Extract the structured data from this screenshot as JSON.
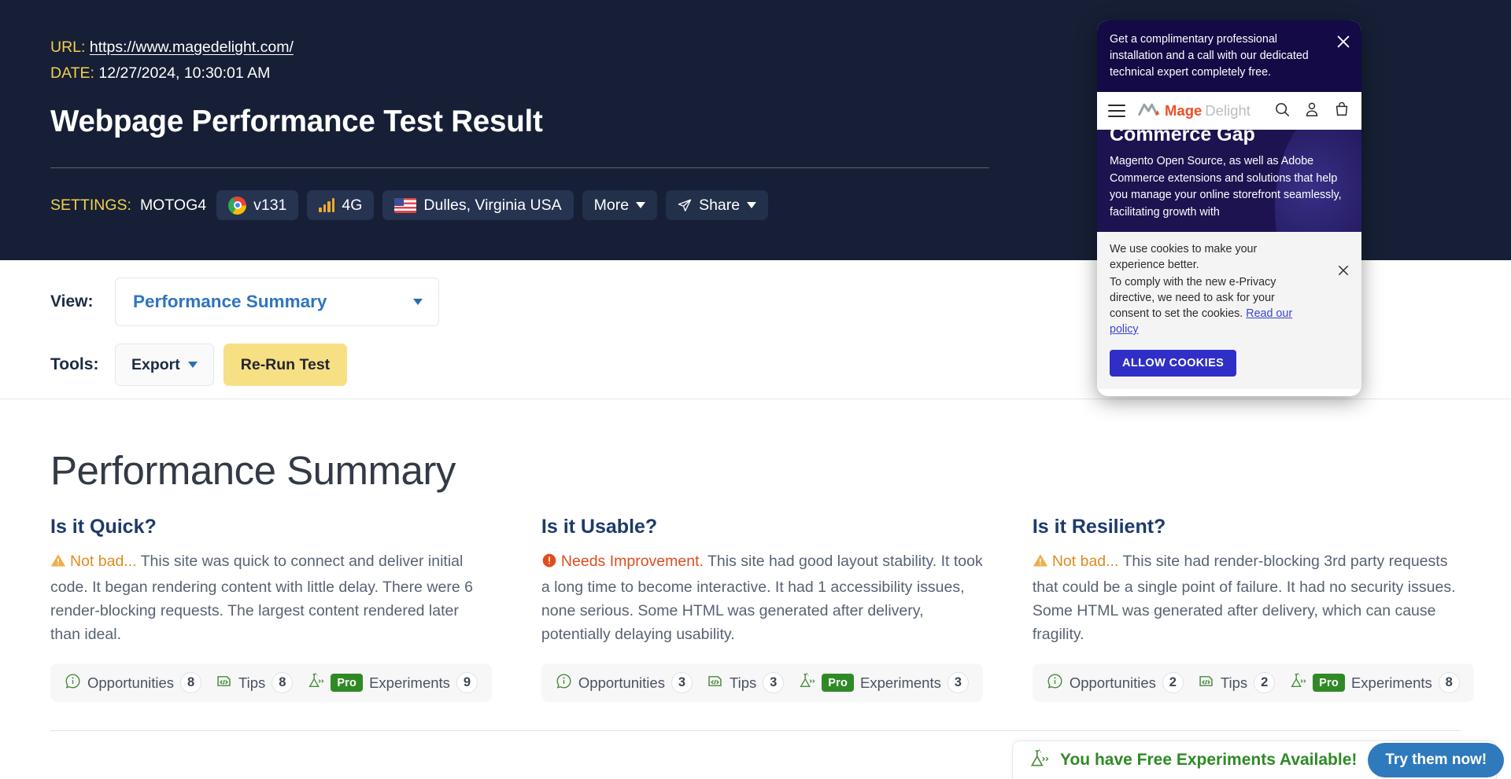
{
  "header": {
    "url_label": "URL:",
    "url_value": "https://www.magedelight.com/",
    "date_label": "DATE:",
    "date_value": "12/27/2024, 10:30:01 AM",
    "title": "Webpage Performance Test Result",
    "settings_label": "SETTINGS:",
    "device": "MOTOG4",
    "browser": "v131",
    "connection": "4G",
    "location": "Dulles, Virginia USA",
    "more": "More",
    "share": "Share"
  },
  "controls": {
    "view_label": "View:",
    "view_value": "Performance Summary",
    "tools_label": "Tools:",
    "export_label": "Export",
    "rerun_label": "Re-Run Test"
  },
  "main": {
    "title": "Performance Summary",
    "columns": [
      {
        "heading": "Is it Quick?",
        "verdict": "Not bad...",
        "verdict_kind": "warn",
        "body": "This site was quick to connect and deliver initial code. It began rendering content with little delay. There were 6 render-blocking requests. The largest content rendered later than ideal.",
        "chips": {
          "opportunities_label": "Opportunities",
          "opportunities_count": "8",
          "tips_label": "Tips",
          "tips_count": "8",
          "pro_label": "Pro",
          "experiments_label": "Experiments",
          "experiments_count": "9"
        }
      },
      {
        "heading": "Is it Usable?",
        "verdict": "Needs Improvement.",
        "verdict_kind": "bad",
        "body": "This site had good layout stability. It took a long time to become interactive. It had 1 accessibility issues, none serious. Some HTML was generated after delivery, potentially delaying usability.",
        "chips": {
          "opportunities_label": "Opportunities",
          "opportunities_count": "3",
          "tips_label": "Tips",
          "tips_count": "3",
          "pro_label": "Pro",
          "experiments_label": "Experiments",
          "experiments_count": "3"
        }
      },
      {
        "heading": "Is it Resilient?",
        "verdict": "Not bad...",
        "verdict_kind": "warn",
        "body": "This site had render-blocking 3rd party requests that could be a single point of failure. It had no security issues. Some HTML was generated after delivery, which can cause fragility.",
        "chips": {
          "opportunities_label": "Opportunities",
          "opportunities_count": "2",
          "tips_label": "Tips",
          "tips_count": "2",
          "pro_label": "Pro",
          "experiments_label": "Experiments",
          "experiments_count": "8"
        }
      }
    ]
  },
  "free_banner": {
    "text": "You have Free Experiments Available!",
    "button": "Try them now!"
  },
  "preview": {
    "promo": "Get a complimentary professional installation and a call with our dedicated technical expert completely free.",
    "logo_mage": "Mage",
    "logo_delight": "Delight",
    "hero_title": "Commerce Gap",
    "hero_body": "Magento Open Source, as well as Adobe Commerce extensions and solutions that help you manage your online storefront seamlessly, facilitating growth with",
    "cookie_line1": "We use cookies to make your experience better.",
    "cookie_line2": "To comply with the new e-Privacy directive, we need to ask for your consent to set the cookies.",
    "cookie_link": "Read our policy",
    "allow_button": "ALLOW COOKIES"
  },
  "colors": {
    "header_bg": "#161f35",
    "accent_yellow": "#f3d04e",
    "link_blue": "#2f74c0",
    "warn_orange": "#e08b1e",
    "bad_orange": "#e04d1e",
    "green": "#2f8a26",
    "rerun_yellow": "#f7df84",
    "try_blue": "#2f79bd"
  }
}
